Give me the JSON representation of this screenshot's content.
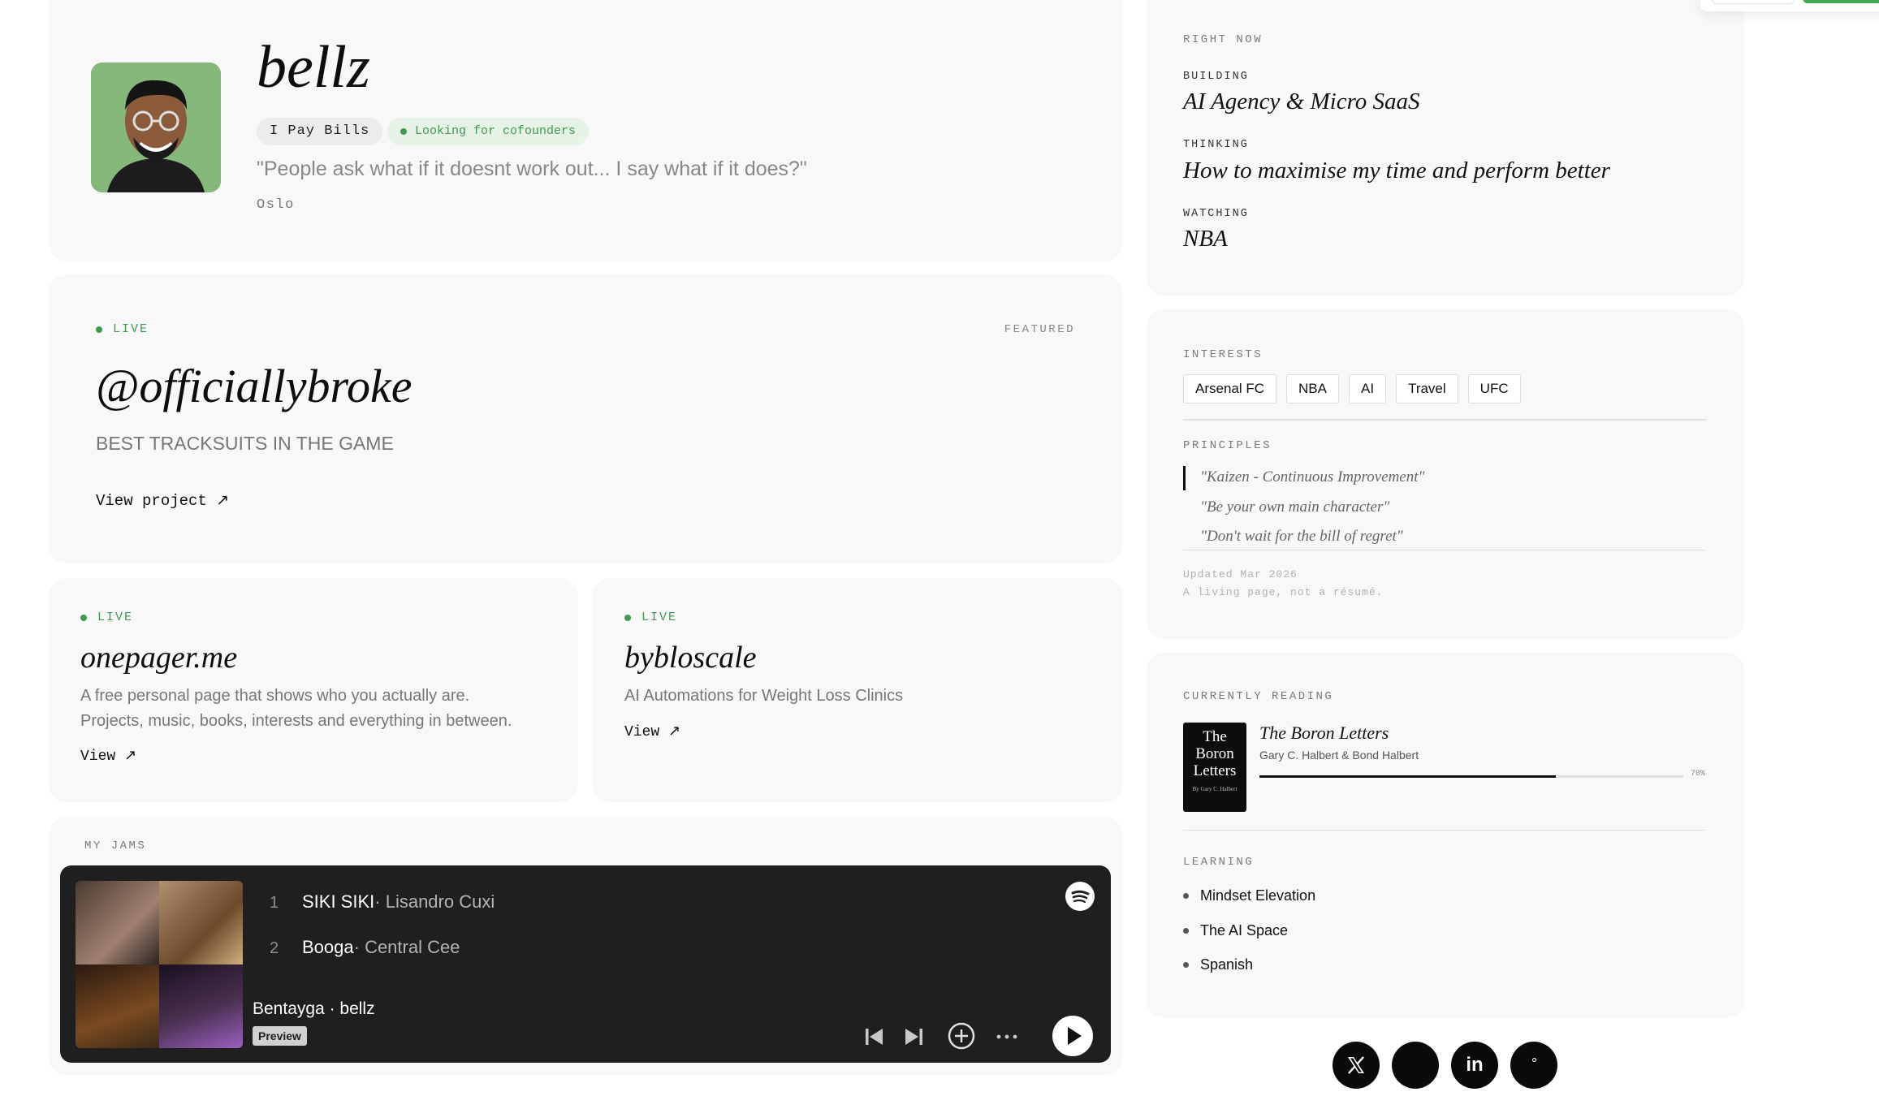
{
  "profile": {
    "name": "bellz",
    "tag": "I Pay Bills",
    "status": "Looking for cofounders",
    "quote": "\"People ask what if it doesnt work out... I say what if it does?\"",
    "location": "Oslo"
  },
  "featured": {
    "live": "LIVE",
    "featured_label": "FEATURED",
    "title": "@officiallybroke",
    "subtitle": "BEST TRACKSUITS IN THE GAME",
    "link": "View project ↗"
  },
  "projects": [
    {
      "live": "LIVE",
      "title": "onepager.me",
      "desc1": "A free personal page that shows who you actually are.",
      "desc2": "Projects, music, books, interests and everything in between.",
      "link": "View ↗"
    },
    {
      "live": "LIVE",
      "title": "bybloscale",
      "desc1": "AI Automations for Weight Loss Clinics",
      "link": "View ↗"
    }
  ],
  "jams": {
    "label": "MY JAMS",
    "tracks": [
      {
        "num": "1",
        "title": "SIKI SIKI",
        "artist": " · Lisandro Cuxi"
      },
      {
        "num": "2",
        "title": "Booga",
        "artist": " · Central Cee"
      }
    ],
    "playlist": "Bentayga · bellz",
    "preview": "Preview"
  },
  "right_now": {
    "label": "RIGHT NOW",
    "building_label": "BUILDING",
    "building": "AI Agency & Micro SaaS",
    "thinking_label": "THINKING",
    "thinking": "How to maximise my time and perform better",
    "watching_label": "WATCHING",
    "watching": "NBA"
  },
  "interests": {
    "label": "INTERESTS",
    "items": [
      "Arsenal FC",
      "NBA",
      "AI",
      "Travel",
      "UFC"
    ]
  },
  "principles": {
    "label": "PRINCIPLES",
    "items": [
      "\"Kaizen - Continuous Improvement\"",
      "\"Be your own main character\"",
      "\"Don't wait for the bill of regret\""
    ]
  },
  "footer_note": {
    "updated": "Updated Mar 2026",
    "tagline": "A living page, not a résumé."
  },
  "reading": {
    "label": "CURRENTLY READING",
    "cover_line1": "The",
    "cover_line2": "Boron",
    "cover_line3": "Letters",
    "cover_author": "By Gary C. Halbert",
    "title": "The Boron Letters",
    "author": "Gary C. Halbert & Bond Halbert",
    "progress": 0.7,
    "progress_label": "70%"
  },
  "learning": {
    "label": "LEARNING",
    "items": [
      "Mindset Elevation",
      "The AI Space",
      "Spanish"
    ]
  },
  "social": {
    "x_icon": "x-logo-icon",
    "linkedin_label": "in",
    "linkedin_icon": "linkedin-icon",
    "instagram_icon": "instagram-icon",
    "blank_icon": "social-icon"
  },
  "colors": {
    "live_green": "#3f9a50",
    "player_bg": "#1f1f1f",
    "card_bg": "#f8f8f8"
  }
}
